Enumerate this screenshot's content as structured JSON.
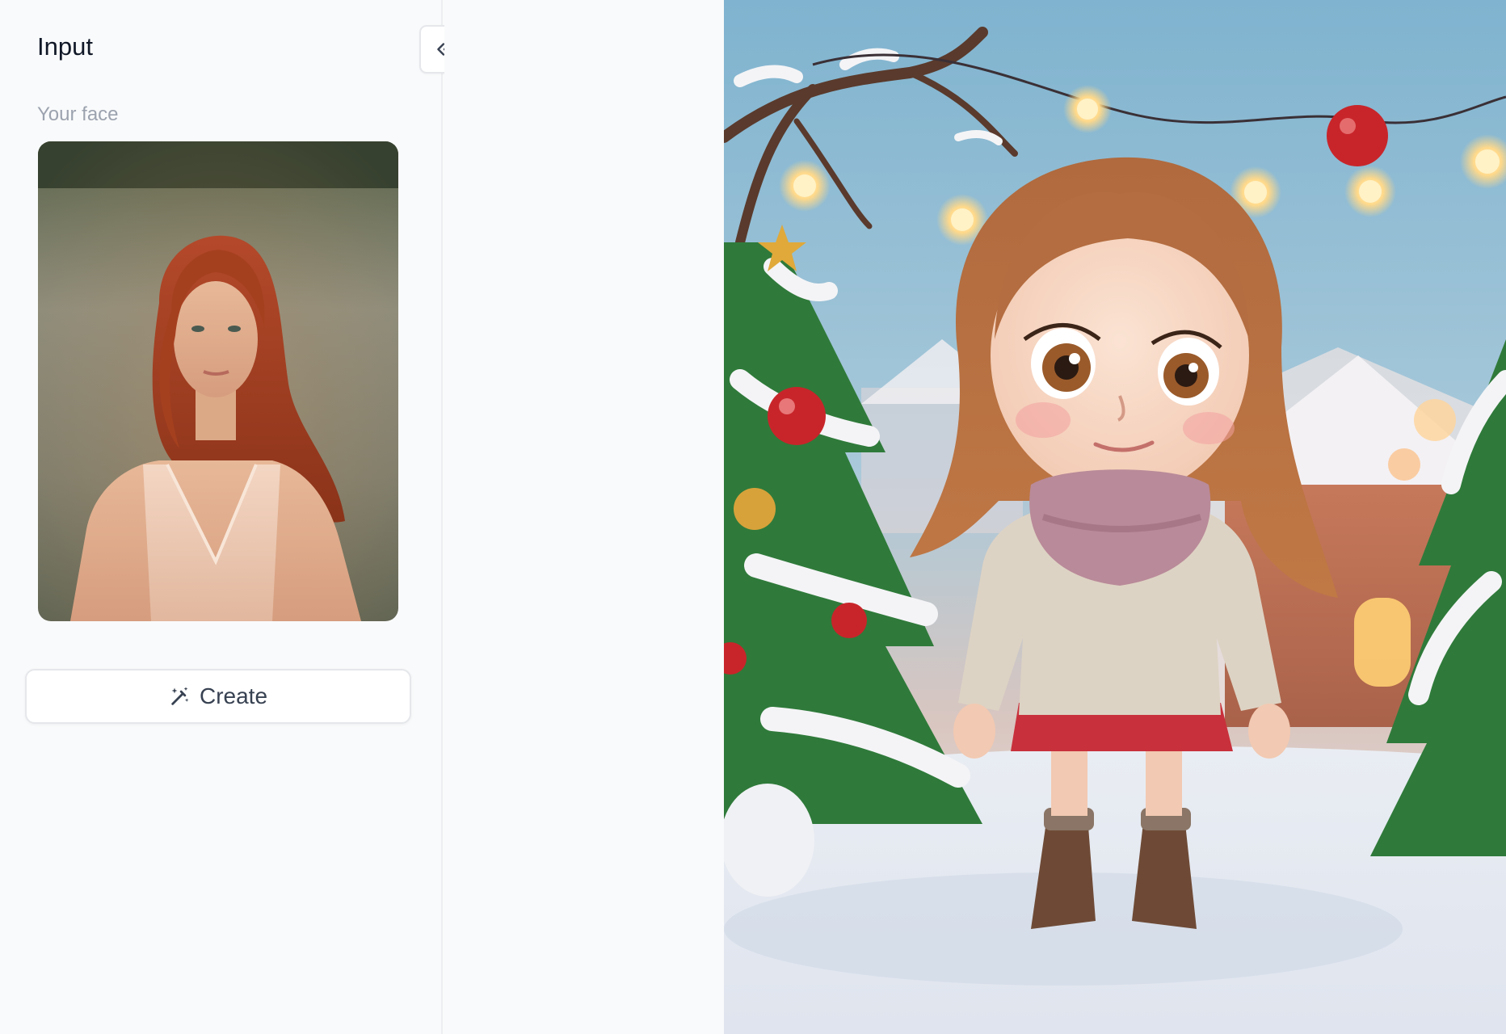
{
  "panel": {
    "title": "Input",
    "face_label": "Your face",
    "create_label": "Create"
  },
  "icons": {
    "collapse": "double-chevron-left-icon",
    "create": "magic-wand-icon"
  },
  "images": {
    "face_photo": "portrait photo of a red-haired woman in a field",
    "result_image": "3D cartoon girl with auburn hair, pink scarf and beige sweater in a snowy Christmas village"
  },
  "colors": {
    "panel_bg": "#f9fafb",
    "border": "#e5e7eb",
    "label_muted": "#9ca3af",
    "button_text": "#374151"
  }
}
